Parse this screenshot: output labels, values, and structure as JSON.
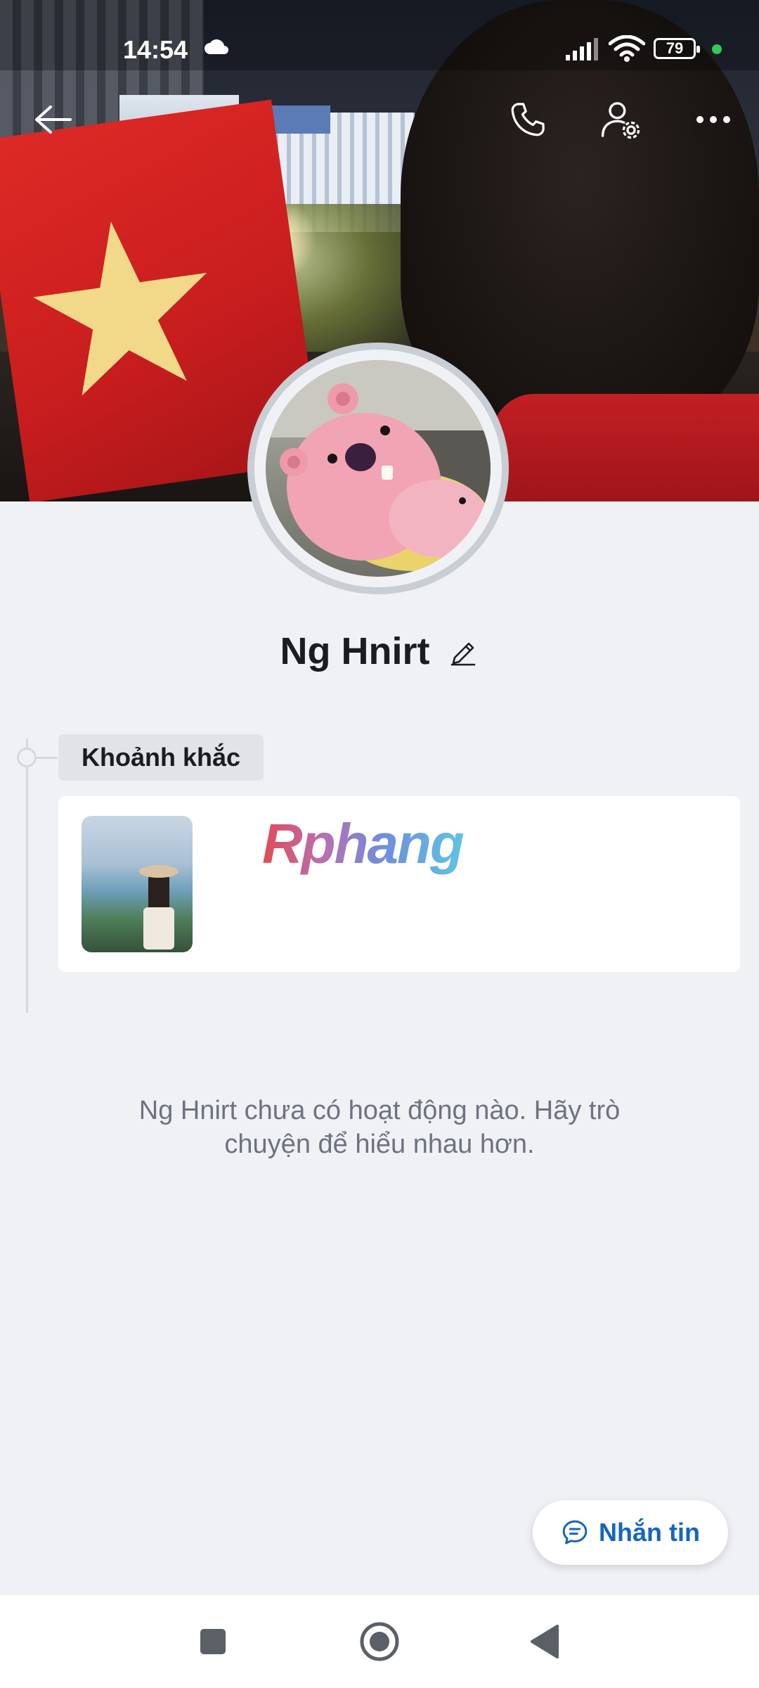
{
  "status_bar": {
    "time": "14:54",
    "battery": "79",
    "weather_icon": "cloud-icon",
    "signal_icon": "cell-signal-icon",
    "wifi_icon": "wifi-icon"
  },
  "header": {
    "back_icon": "arrow-left-icon",
    "call_icon": "phone-icon",
    "settings_icon": "user-settings-icon",
    "more_icon": "more-horizontal-icon"
  },
  "profile": {
    "name": "Ng Hnirt",
    "edit_icon": "pencil-icon"
  },
  "moments": {
    "label": "Khoảnh khắc",
    "watermark": "Rphang"
  },
  "empty_state": {
    "message": "Ng Hnirt chưa có hoạt động nào. Hãy trò chuyện để hiểu nhau hơn."
  },
  "message_button": {
    "label": "Nhắn tin",
    "icon": "chat-bubble-icon",
    "color": "#1565c0"
  },
  "nav_bar": {
    "recent_icon": "square-icon",
    "home_icon": "circle-home-icon",
    "back_icon": "triangle-back-icon"
  }
}
